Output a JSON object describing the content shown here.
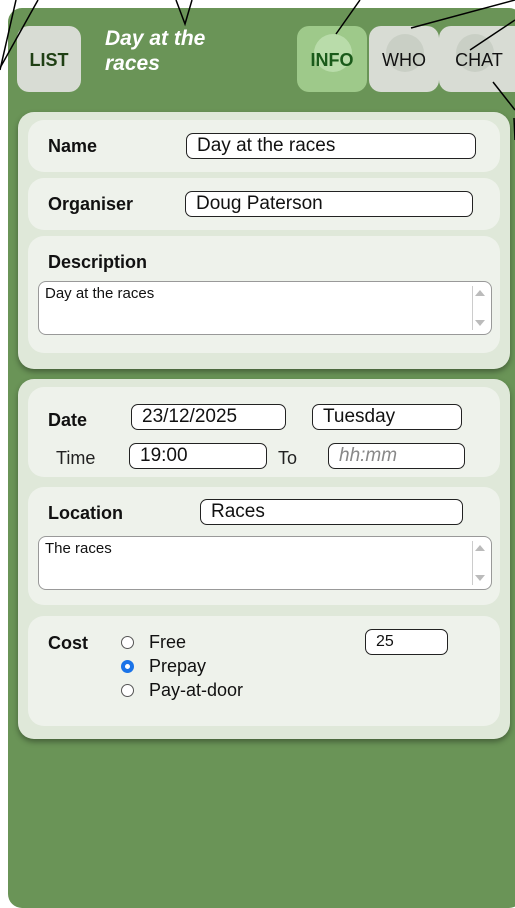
{
  "header": {
    "list_label": "LIST",
    "title_line1": "Day at the",
    "title_line2": "races",
    "tabs": [
      {
        "label": "INFO",
        "active": true
      },
      {
        "label": "WHO",
        "active": false
      },
      {
        "label": "CHAT",
        "active": false
      }
    ]
  },
  "event": {
    "name_label": "Name",
    "name_value": "Day at the races",
    "organiser_label": "Organiser",
    "organiser_value": "Doug Paterson",
    "description_label": "Description",
    "description_value": "Day at the races"
  },
  "schedule": {
    "date_label": "Date",
    "date_value": "23/12/2025",
    "weekday_value": "Tuesday",
    "time_label": "Time",
    "time_value": "19:00",
    "to_label": "To",
    "to_placeholder": "hh:mm"
  },
  "location": {
    "label": "Location",
    "value": "Races",
    "details": "The races"
  },
  "cost": {
    "label": "Cost",
    "options": [
      {
        "label": "Free",
        "selected": false
      },
      {
        "label": "Prepay",
        "selected": true
      },
      {
        "label": "Pay-at-door",
        "selected": false
      }
    ],
    "amount": "25"
  },
  "colors": {
    "app_background": "#6a9457",
    "accent": "#1a73e8"
  }
}
